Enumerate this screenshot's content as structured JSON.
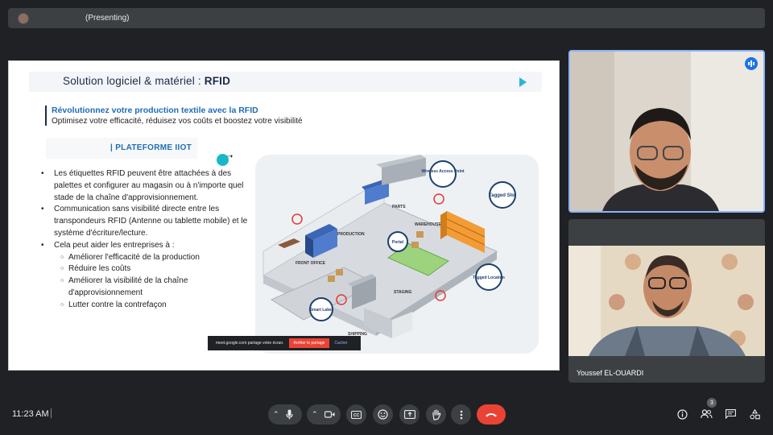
{
  "topbar": {
    "presenting_label": "(Presenting)"
  },
  "slide": {
    "title_prefix": "Solution logiciel & matériel : ",
    "title_bold": "RFID",
    "subtitle1": "Révolutionnez votre production textile avec la RFID",
    "subtitle2": "Optimisez votre efficacité, réduisez vos coûts et boostez votre visibilité",
    "platform_label": "PLATEFORME IIOT",
    "bullets": [
      "Les étiquettes RFID peuvent être attachées à des palettes et configurer au magasin ou à n'importe quel stade de la chaîne d'approvisionnement.",
      "Communication sans visibilité directe entre les transpondeurs RFID (Antenne ou tablette mobile) et le système d'écriture/lecture.",
      "Cela peut aider les entreprises à :"
    ],
    "sub_bullets": [
      "Améliorer l'efficacité de la production",
      "Réduire les coûts",
      "Améliorer la visibilité de la chaîne d'approvisionnement",
      "Lutter contre la contrefaçon"
    ],
    "diagram_labels": {
      "wireless": "Wireless Access Point",
      "tagged_slot": "Tagged Slot",
      "parts": "PARTS",
      "warehouse": "WAREHOUSE",
      "production": "PRODUCTION",
      "portal": "Portal",
      "front_office": "FRONT OFFICE",
      "tagged_location": "Tagged Location",
      "staging": "STAGING",
      "smart_label": "Smart Label",
      "shipping": "SHIPPING"
    }
  },
  "share_bar": {
    "text": "meet.google.com partage votre écran.",
    "stop_label": "Arrêter le partage",
    "hide_label": "Cacher"
  },
  "participants": [
    {
      "name": ""
    },
    {
      "name": "Youssef EL-OUARDI"
    }
  ],
  "bottom": {
    "time": "11:23 AM",
    "people_count": "3"
  },
  "colors": {
    "accent_blue": "#1e6db5",
    "end_call": "#ea4335",
    "speaking": "#1a73e8"
  }
}
